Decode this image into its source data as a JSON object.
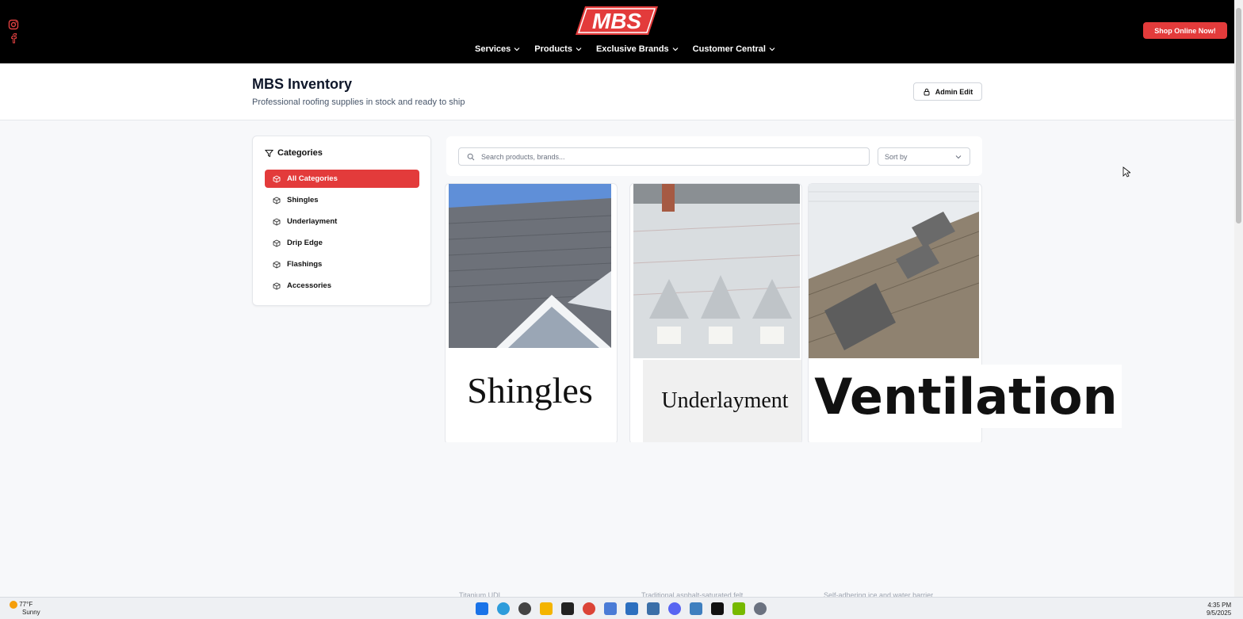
{
  "brand": {
    "logo_text": "MBS",
    "accent": "#e33b3b"
  },
  "topbar": {
    "nav": [
      {
        "label": "Services"
      },
      {
        "label": "Products"
      },
      {
        "label": "Exclusive Brands"
      },
      {
        "label": "Customer Central"
      }
    ],
    "shop_button": "Shop Online Now!"
  },
  "header": {
    "title": "MBS Inventory",
    "subtitle": "Professional roofing supplies in stock and ready to ship",
    "admin_button": "Admin Edit"
  },
  "sidebar": {
    "heading": "Categories",
    "items": [
      {
        "label": "All Categories",
        "active": true
      },
      {
        "label": "Shingles"
      },
      {
        "label": "Underlayment"
      },
      {
        "label": "Drip Edge"
      },
      {
        "label": "Flashings"
      },
      {
        "label": "Accessories"
      }
    ]
  },
  "search": {
    "placeholder": "Search products, brands...",
    "sort_label": "Sort by"
  },
  "cards": [
    {
      "overlay_label": "Shingles",
      "peek_text": "Titanium UDL"
    },
    {
      "overlay_label": "Underlayment",
      "peek_text": "Traditional asphalt-saturated felt"
    },
    {
      "overlay_label": "Ventilation",
      "peek_text": "Self-adhering ice and water barrier"
    }
  ],
  "taskbar": {
    "weather_temp": "77°F",
    "weather_desc": "Sunny",
    "time": "4:35 PM",
    "date": "9/5/2025"
  }
}
